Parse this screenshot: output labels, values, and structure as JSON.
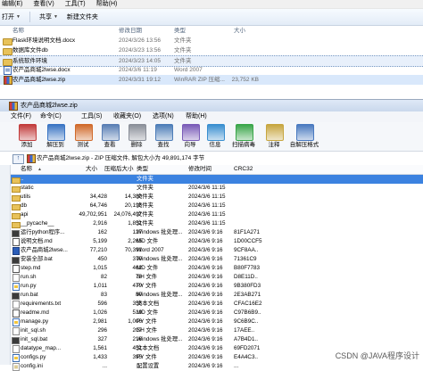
{
  "explorer": {
    "menu": [
      "编辑(E)",
      "查看(V)",
      "工具(T)",
      "帮助(H)"
    ],
    "toolbar": {
      "open": "打开",
      "share": "共享",
      "new_folder": "新建文件夹"
    },
    "header": {
      "name": "名称",
      "date": "修改日期",
      "type": "类型",
      "size": "大小"
    },
    "files": [
      {
        "name": "Flask环境说明文档.docx",
        "date": "2024/3/26 13:56",
        "type": "文件夹",
        "size": "",
        "icon": "folder"
      },
      {
        "name": "数据库文件db",
        "date": "2024/3/23 13:56",
        "type": "文件夹",
        "size": "",
        "icon": "folder"
      },
      {
        "name": "系统软件环境",
        "date": "2024/3/23 14:05",
        "type": "文件夹",
        "size": "",
        "icon": "folder"
      },
      {
        "name": "农产品商城2lwse.docx",
        "date": "2024/3/6 11:19",
        "type": "Word 2007",
        "size": "",
        "icon": "word"
      },
      {
        "name": "农产品商城2lwse.zip",
        "date": "2024/3/31 19:12",
        "type": "WinRAR ZIP 压缩...",
        "size": "23,752 KB",
        "icon": "zip"
      }
    ]
  },
  "winrar": {
    "title": "农产品商城2lwse.zip",
    "menu": [
      "文件(F)",
      "命令(C)",
      "工具(S)",
      "收藏夹(O)",
      "选项(N)",
      "帮助(H)"
    ],
    "toolbar": [
      {
        "label": "添加",
        "icon": "add-icon",
        "color": "#c23c3c"
      },
      {
        "label": "解压到",
        "icon": "extract-icon",
        "color": "#3a75c4"
      },
      {
        "label": "测试",
        "icon": "test-icon",
        "color": "#d06a2b"
      },
      {
        "label": "查看",
        "icon": "view-icon",
        "color": "#5a7fb5"
      },
      {
        "label": "删除",
        "icon": "delete-icon",
        "color": "#8a8f99"
      },
      {
        "label": "查找",
        "icon": "find-icon",
        "color": "#4d7db8"
      },
      {
        "label": "向导",
        "icon": "wizard-icon",
        "color": "#7a5cb8"
      },
      {
        "label": "信息",
        "icon": "info-icon",
        "color": "#3a8fd0"
      },
      {
        "label": "扫描病毒",
        "icon": "scan-icon",
        "color": "#3aa64a"
      },
      {
        "label": "注释",
        "icon": "comment-icon",
        "color": "#c7a640"
      },
      {
        "label": "自解压格式",
        "icon": "sfx-icon",
        "color": "#4a7ac0"
      }
    ],
    "path": "农产品商城2lwse.zip - ZIP 压缩文件, 解包大小为 49,891,174 字节",
    "up_symbol": "↑",
    "columns": {
      "name": "名称",
      "size": "大小",
      "packed": "压缩后大小",
      "type": "类型",
      "modified": "修改时间",
      "crc": "CRC32"
    },
    "rows": [
      {
        "name": "..",
        "size": "",
        "packed": "",
        "type": "文件夹",
        "modified": "",
        "crc": "",
        "icon": "folder",
        "selected": true
      },
      {
        "name": "static",
        "size": "",
        "packed": "",
        "type": "文件夹",
        "modified": "2024/3/6 11:15",
        "crc": "",
        "icon": "folder"
      },
      {
        "name": "utils",
        "size": "34,428",
        "packed": "14,380",
        "type": "文件夹",
        "modified": "2024/3/6 11:15",
        "crc": "",
        "icon": "folder"
      },
      {
        "name": "db",
        "size": "64,746",
        "packed": "20,195",
        "type": "文件夹",
        "modified": "2024/3/6 11:15",
        "crc": "",
        "icon": "folder"
      },
      {
        "name": "api",
        "size": "49,702,951",
        "packed": "24,076,497",
        "type": "文件夹",
        "modified": "2024/3/6 11:15",
        "crc": "",
        "icon": "folder"
      },
      {
        "name": "__pycache__",
        "size": "2,916",
        "packed": "1,851",
        "type": "文件夹",
        "modified": "2024/3/6 11:15",
        "crc": "",
        "icon": "folder"
      },
      {
        "name": "运行python程序...",
        "size": "162",
        "packed": "127",
        "type": "Windows 批处理...",
        "modified": "2024/3/6 9:16",
        "crc": "81F1A271",
        "icon": "bat"
      },
      {
        "name": "说明文档.md",
        "size": "5,199",
        "packed": "2,265",
        "type": "MD 文件",
        "modified": "2024/3/6 9:16",
        "crc": "1D00CCF5",
        "icon": "md"
      },
      {
        "name": "农产品商城2lwse...",
        "size": "77,210",
        "packed": "70,391",
        "type": "Word 2007",
        "modified": "2024/3/6 9:16",
        "crc": "9CF8AA..",
        "icon": "word"
      },
      {
        "name": "安装全部.bat",
        "size": "450",
        "packed": "370",
        "type": "Windows 批处理...",
        "modified": "2024/3/6 9:16",
        "crc": "71361C9",
        "icon": "bat"
      },
      {
        "name": "step.md",
        "size": "1,015",
        "packed": "462",
        "type": "MD 文件",
        "modified": "2024/3/6 9:16",
        "crc": "B80F7783",
        "icon": "md"
      },
      {
        "name": "run.sh",
        "size": "82",
        "packed": "78",
        "type": "SH 文件",
        "modified": "2024/3/6 9:16",
        "crc": "D8E11D..",
        "icon": "file"
      },
      {
        "name": "run.py",
        "size": "1,011",
        "packed": "479",
        "type": "PY 文件",
        "modified": "2024/3/6 9:16",
        "crc": "9B380FD3",
        "icon": "py"
      },
      {
        "name": "run.bat",
        "size": "83",
        "packed": "80",
        "type": "Windows 批处理...",
        "modified": "2024/3/6 9:16",
        "crc": "2E3AB271",
        "icon": "bat"
      },
      {
        "name": "requirements.txt",
        "size": "596",
        "packed": "355",
        "type": "文本文档",
        "modified": "2024/3/6 9:16",
        "crc": "CFAC16E2",
        "icon": "file"
      },
      {
        "name": "readme.md",
        "size": "1,026",
        "packed": "519",
        "type": "MD 文件",
        "modified": "2024/3/6 9:16",
        "crc": "C97B6B9..",
        "icon": "md"
      },
      {
        "name": "manage.py",
        "size": "2,981",
        "packed": "1,006",
        "type": "PY 文件",
        "modified": "2024/3/6 9:16",
        "crc": "9C6B9C..",
        "icon": "py"
      },
      {
        "name": "init_sql.sh",
        "size": "296",
        "packed": "207",
        "type": "SH 文件",
        "modified": "2024/3/6 9:16",
        "crc": "17AEE..",
        "icon": "file"
      },
      {
        "name": "init_sql.bat",
        "size": "327",
        "packed": "216",
        "type": "Windows 批处理...",
        "modified": "2024/3/6 9:16",
        "crc": "A7B4D1..",
        "icon": "bat"
      },
      {
        "name": "datatype_map...",
        "size": "1,561",
        "packed": "451",
        "type": "文本文档",
        "modified": "2024/3/6 9:16",
        "crc": "69FD2071",
        "icon": "file"
      },
      {
        "name": "configs.py",
        "size": "1,433",
        "packed": "395",
        "type": "PY 文件",
        "modified": "2024/3/6 9:16",
        "crc": "E4A4C3..",
        "icon": "py"
      },
      {
        "name": "config.ini",
        "size": "...",
        "packed": "...",
        "type": "配置设置",
        "modified": "2024/3/6 9:16",
        "crc": "...",
        "icon": "ini"
      }
    ]
  },
  "watermark": "CSDN @JAVA程序设计"
}
